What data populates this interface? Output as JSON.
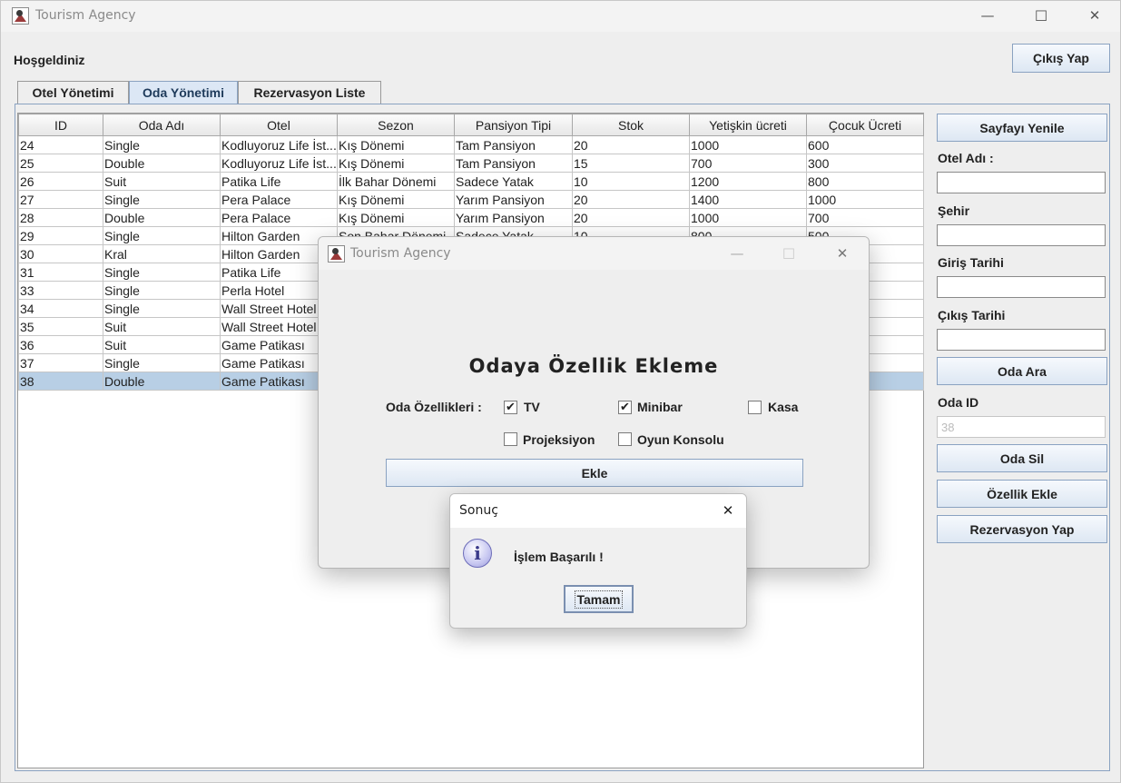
{
  "window": {
    "title": "Tourism Agency",
    "minimize": "—",
    "maximize": "☐",
    "close": "✕"
  },
  "header": {
    "welcome": "Hoşgeldiniz",
    "logout_button": "Çıkış Yap"
  },
  "tabs": [
    {
      "label": "Otel Yönetimi",
      "active": false
    },
    {
      "label": "Oda Yönetimi",
      "active": true
    },
    {
      "label": "Rezervasyon Liste",
      "active": false
    }
  ],
  "table": {
    "columns": [
      "ID",
      "Oda Adı",
      "Otel",
      "Sezon",
      "Pansiyon Tipi",
      "Stok",
      "Yetişkin ücreti",
      "Çocuk Ücreti"
    ],
    "rows": [
      [
        "24",
        "Single",
        "Kodluyoruz Life İst...",
        "Kış Dönemi",
        "Tam Pansiyon",
        "20",
        "1000",
        "600"
      ],
      [
        "25",
        "Double",
        "Kodluyoruz Life İst...",
        "Kış Dönemi",
        "Tam Pansiyon",
        "15",
        "700",
        "300"
      ],
      [
        "26",
        "Suit",
        "Patika Life",
        "İlk Bahar Dönemi",
        "Sadece Yatak",
        "10",
        "1200",
        "800"
      ],
      [
        "27",
        "Single",
        "Pera Palace",
        "Kış Dönemi",
        "Yarım Pansiyon",
        "20",
        "1400",
        "1000"
      ],
      [
        "28",
        "Double",
        "Pera Palace",
        "Kış Dönemi",
        "Yarım Pansiyon",
        "20",
        "1000",
        "700"
      ],
      [
        "29",
        "Single",
        "Hilton Garden",
        "Son Bahar Dönemi",
        "Sadece Yatak",
        "10",
        "800",
        "500"
      ],
      [
        "30",
        "Kral",
        "Hilton Garden",
        "",
        "",
        "",
        "",
        ""
      ],
      [
        "31",
        "Single",
        "Patika Life",
        "",
        "",
        "",
        "",
        ""
      ],
      [
        "33",
        "Single",
        "Perla Hotel",
        "",
        "",
        "",
        "",
        ""
      ],
      [
        "34",
        "Single",
        "Wall Street Hotel",
        "",
        "",
        "",
        "",
        ""
      ],
      [
        "35",
        "Suit",
        "Wall Street Hotel",
        "",
        "",
        "",
        "",
        ""
      ],
      [
        "36",
        "Suit",
        "Game Patikası",
        "",
        "",
        "",
        "",
        ""
      ],
      [
        "37",
        "Single",
        "Game Patikası",
        "",
        "",
        "",
        "",
        ""
      ],
      [
        "38",
        "Double",
        "Game Patikası",
        "",
        "",
        "",
        "",
        ""
      ]
    ],
    "selected_row_index": 13
  },
  "right_panel": {
    "refresh_button": "Sayfayı Yenile",
    "hotel_name_label": "Otel Adı :",
    "hotel_name_value": "",
    "city_label": "Şehir",
    "city_value": "",
    "checkin_label": "Giriş Tarihi",
    "checkin_value": "",
    "checkout_label": "Çıkış Tarihi",
    "checkout_value": "",
    "search_button": "Oda Ara",
    "room_id_label": "Oda ID",
    "room_id_value": "38",
    "delete_button": "Oda Sil",
    "add_feature_button": "Özellik Ekle",
    "reserve_button": "Rezervasyon Yap"
  },
  "feature_dialog": {
    "title": "Tourism Agency",
    "heading": "Odaya Özellik Ekleme",
    "features_label": "Oda Özellikleri :",
    "options": [
      {
        "label": "TV",
        "checked": true
      },
      {
        "label": "Minibar",
        "checked": true
      },
      {
        "label": "Kasa",
        "checked": false
      },
      {
        "label": "Projeksiyon",
        "checked": false
      },
      {
        "label": "Oyun Konsolu",
        "checked": false
      }
    ],
    "add_button": "Ekle"
  },
  "message_dialog": {
    "title": "Sonuç",
    "message": "İşlem Başarılı !",
    "ok_button": "Tamam",
    "close": "✕",
    "icon": "info-icon",
    "icon_glyph": "i"
  }
}
